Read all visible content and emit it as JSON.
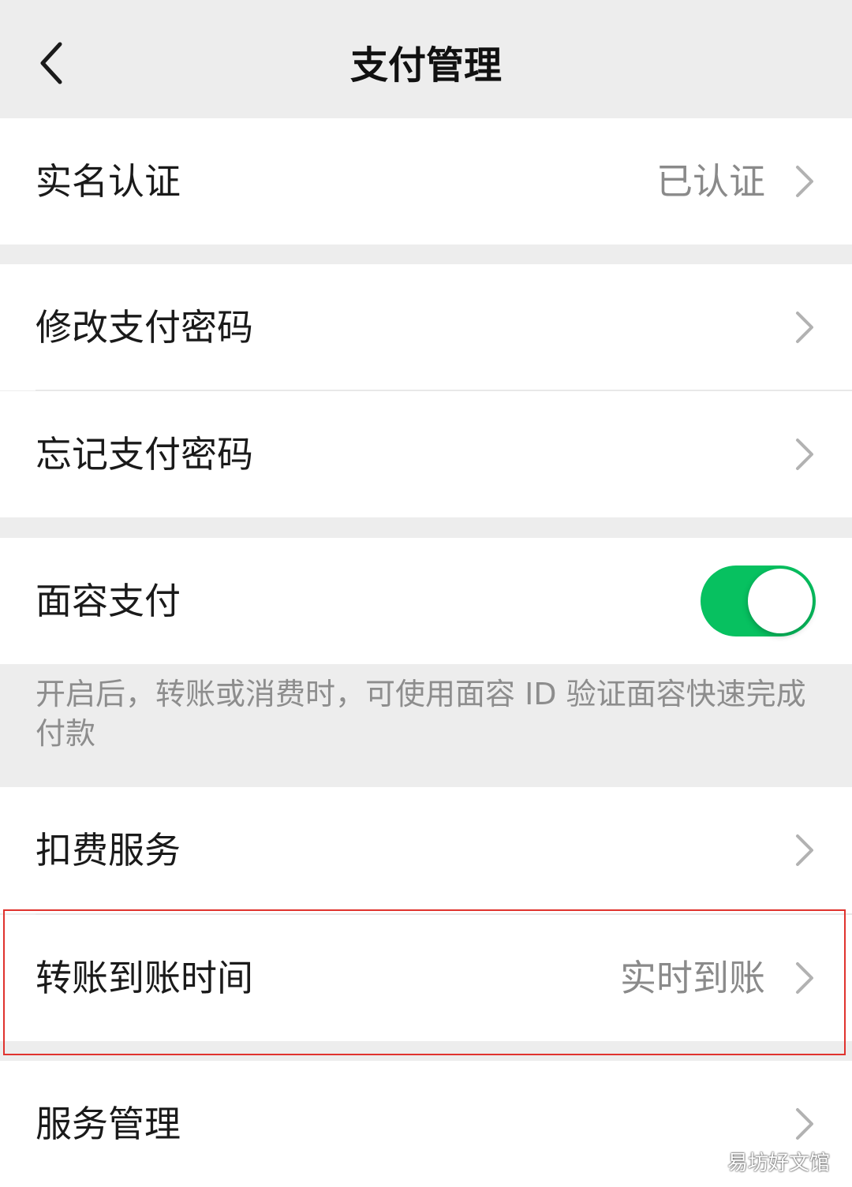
{
  "nav": {
    "title": "支付管理",
    "back_icon": "chevron-left-icon"
  },
  "items": {
    "real_name": {
      "label": "实名认证",
      "value": "已认证"
    },
    "change_password": {
      "label": "修改支付密码"
    },
    "forget_password": {
      "label": "忘记支付密码"
    },
    "face_pay": {
      "label": "面容支付",
      "enabled": true
    },
    "face_pay_hint": "开启后，转账或消费时，可使用面容 ID 验证面容快速完成付款",
    "deduction": {
      "label": "扣费服务"
    },
    "transfer_time": {
      "label": "转账到账时间",
      "value": "实时到账"
    },
    "service_mgmt": {
      "label": "服务管理"
    }
  },
  "watermark": "易坊好文馆",
  "colors": {
    "accent_green": "#07c160",
    "highlight_red": "#e0332e",
    "background": "#ededed"
  }
}
